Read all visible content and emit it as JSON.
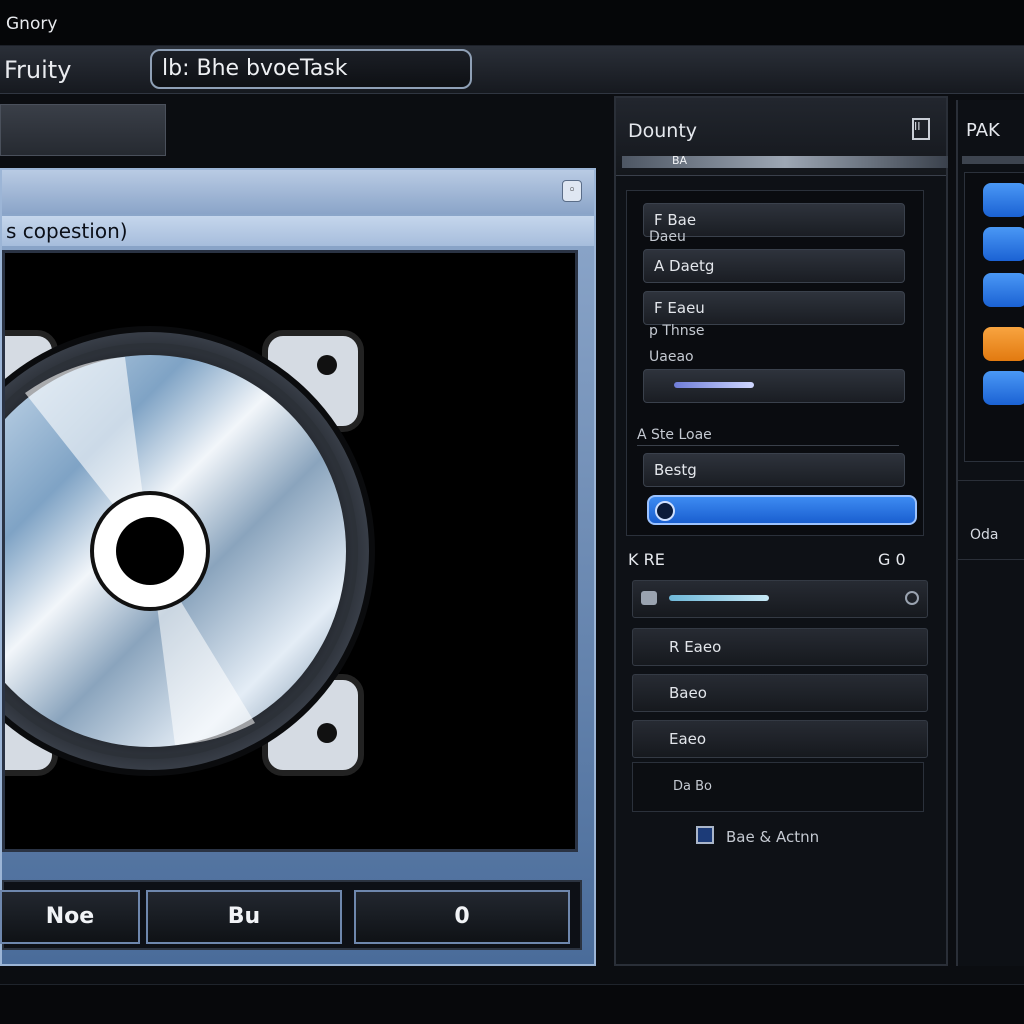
{
  "window": {
    "title": "Gnory"
  },
  "toolbar": {
    "left_label": "Fruity",
    "path": "lb: Bhe bvoeTask"
  },
  "info_box": {
    "line1": "",
    "line2": ""
  },
  "main": {
    "caption": "s copestion)",
    "buttons": {
      "first": "Noe",
      "second": "Bu",
      "third": "0"
    }
  },
  "side": {
    "title": "Dounty",
    "pin_label": "II",
    "tab_label": "BA",
    "group1": {
      "field1": "F Bae",
      "label1": "Daeu",
      "field2": "A Daetg",
      "field3": "F Eaeu",
      "label2": "p Thnse",
      "label3": "Uaeao",
      "sublabel": "A Ste Loae",
      "field4": "Bestg",
      "select": ""
    },
    "section2_title": "K RE",
    "section2_right": "G 0",
    "group2": {
      "row1": "",
      "row2": "R Eaeo",
      "row3": "Baeo",
      "row4": "Eaeo",
      "sub_text": "Da Bo"
    },
    "checkbox_label": "Bae & Actnn"
  },
  "far": {
    "title": "PAK",
    "buttons": [
      "",
      "",
      "",
      "",
      ""
    ],
    "lower_text": "Oda"
  },
  "colors": {
    "accent_blue": "#2a74e6",
    "accent_orange": "#f08a1c",
    "panel_blue": "#8fa9cc"
  }
}
